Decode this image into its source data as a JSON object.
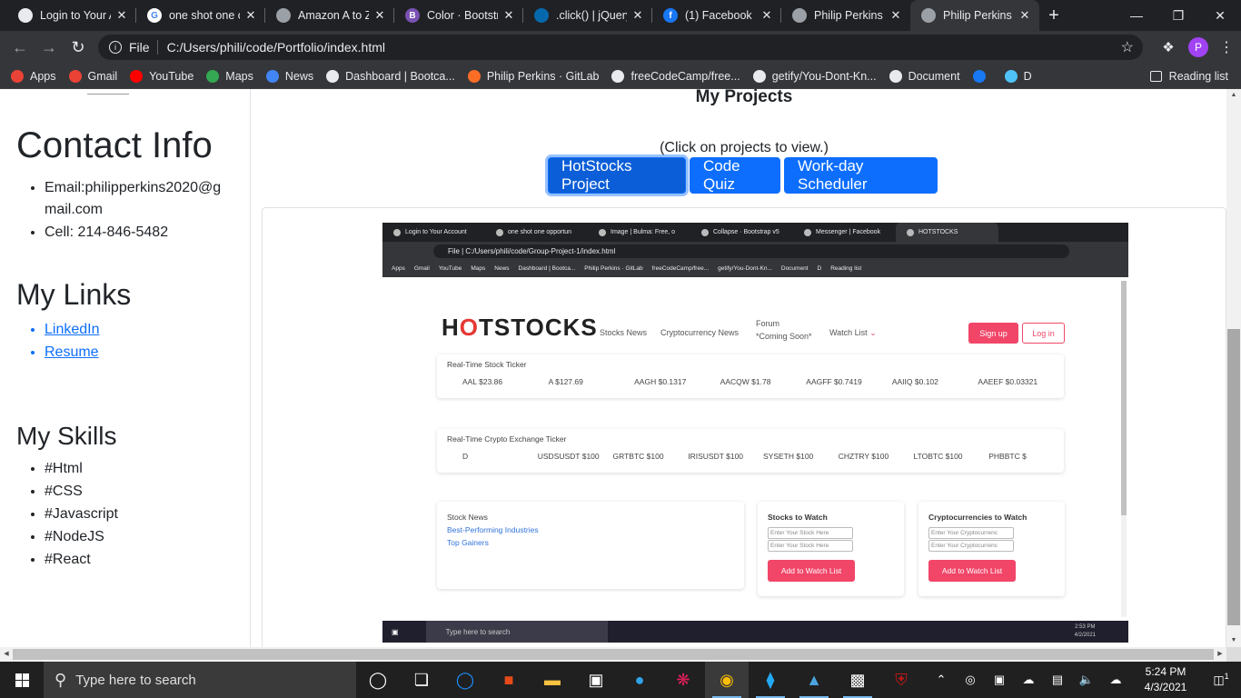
{
  "browser": {
    "tabs": [
      {
        "title": "Login to Your Account",
        "fav_color": "#e8eaed",
        "fav_glyph": ""
      },
      {
        "title": "one shot one opportunity",
        "fav_color": "#ffffff",
        "fav_glyph": "G"
      },
      {
        "title": "Amazon A to Z",
        "fav_color": "#9aa0a6",
        "fav_glyph": ""
      },
      {
        "title": "Color · Bootstrap",
        "fav_color": "#7952b3",
        "fav_glyph": "B"
      },
      {
        "title": ".click() | jQuery",
        "fav_color": "#0769ad",
        "fav_glyph": ""
      },
      {
        "title": "(1) Facebook",
        "fav_color": "#1877f2",
        "fav_glyph": "f"
      },
      {
        "title": "Philip Perkins Portfolio",
        "fav_color": "#9aa0a6",
        "fav_glyph": ""
      },
      {
        "title": "Philip Perkins Portfolio",
        "fav_color": "#9aa0a6",
        "fav_glyph": ""
      }
    ],
    "active_tab_index": 7,
    "new_tab_glyph": "+",
    "window_controls": {
      "minimize": "—",
      "maximize": "❐",
      "close": "✕"
    },
    "address": {
      "scheme_label": "File",
      "url": "C:/Users/phili/code/Portfolio/index.html"
    },
    "profile_initial": "P",
    "bookmarks": [
      {
        "label": "Apps",
        "color": "#ea4335"
      },
      {
        "label": "Gmail",
        "color": "#ea4335"
      },
      {
        "label": "YouTube",
        "color": "#ff0000"
      },
      {
        "label": "Maps",
        "color": "#34a853"
      },
      {
        "label": "News",
        "color": "#4285f4"
      },
      {
        "label": "Dashboard | Bootca...",
        "color": "#e8eaed"
      },
      {
        "label": "Philip Perkins · GitLab",
        "color": "#fc6d26"
      },
      {
        "label": "freeCodeCamp/free...",
        "color": "#e8eaed"
      },
      {
        "label": "getify/You-Dont-Kn...",
        "color": "#e8eaed"
      },
      {
        "label": "Document",
        "color": "#e8eaed"
      },
      {
        "label": "",
        "color": "#1877f2"
      },
      {
        "label": "D",
        "color": "#4fc3f7"
      }
    ],
    "reading_list": "Reading list"
  },
  "sidebar": {
    "contact_title": "Contact Info",
    "email": "Email:philipperkins2020@gmail.com",
    "cell": "Cell: 214-846-5482",
    "links_title": "My Links",
    "links": [
      "LinkedIn",
      "Resume"
    ],
    "skills_title": "My Skills",
    "skills": [
      "#Html",
      "#CSS",
      "#Javascript",
      "#NodeJS",
      "#React"
    ]
  },
  "main": {
    "title": "My Projects",
    "hint": "(Click on projects to view.)",
    "buttons": [
      "HotStocks Project",
      "Code Quiz",
      "Work-day Scheduler"
    ]
  },
  "preview": {
    "tabs": [
      "Login to Your Account",
      "one shot one opportun",
      "Image | Bulma: Free, o",
      "Collapse · Bootstrap v5",
      "Messenger | Facebook",
      "HOTSTOCKS"
    ],
    "url": "File  |  C:/Users/phili/code/Group-Project-1/index.html",
    "bookmarks": [
      "Apps",
      "Gmail",
      "YouTube",
      "Maps",
      "News",
      "Dashboard | Bootca...",
      "Philip Perkins · GitLab",
      "freeCodeCamp/free...",
      "getify/You-Dont-Kn...",
      "Document",
      "D",
      "Reading list"
    ],
    "logo_pre": "H",
    "logo_o": "O",
    "logo_post": "TSTOCKS",
    "nav": [
      "Stocks News",
      "Cryptocurrency News",
      "Forum",
      "*Coming Soon*",
      "Watch List"
    ],
    "signup": "Sign up",
    "login": "Log in",
    "stock_ticker_title": "Real-Time Stock Ticker",
    "stock_ticker": [
      "AAL $23.86",
      "A $127.69",
      "AAGH $0.1317",
      "AACQW $1.78",
      "AAGFF $0.7419",
      "AAIIQ $0.102",
      "AAEEF $0.03321"
    ],
    "crypto_ticker_title": "Real-Time Crypto Exchange Ticker",
    "crypto_ticker": [
      "D",
      "USDSUSDT $100",
      "GRTBTC $100",
      "IRISUSDT $100",
      "SYSETH $100",
      "CHZTRY $100",
      "LTOBTC $100",
      "PHBBTC $"
    ],
    "stock_news": "Stock News",
    "news_links": [
      "Best-Performing Industries",
      "Top Gainers"
    ],
    "stocks_watch": "Stocks to Watch",
    "stock_placeholder": "Enter Your Stock Here",
    "crypto_watch": "Cryptocurrencies to Watch",
    "crypto_placeholder": "Enter Your Cryptocurrenc",
    "add_label": "Add to Watch List",
    "taskbar_search": "Type here to search",
    "clock_time": "2:53 PM",
    "clock_date": "4/2/2021"
  },
  "taskbar": {
    "search": "Type here to search",
    "time": "5:24 PM",
    "date": "4/3/2021",
    "notifications": "1"
  }
}
